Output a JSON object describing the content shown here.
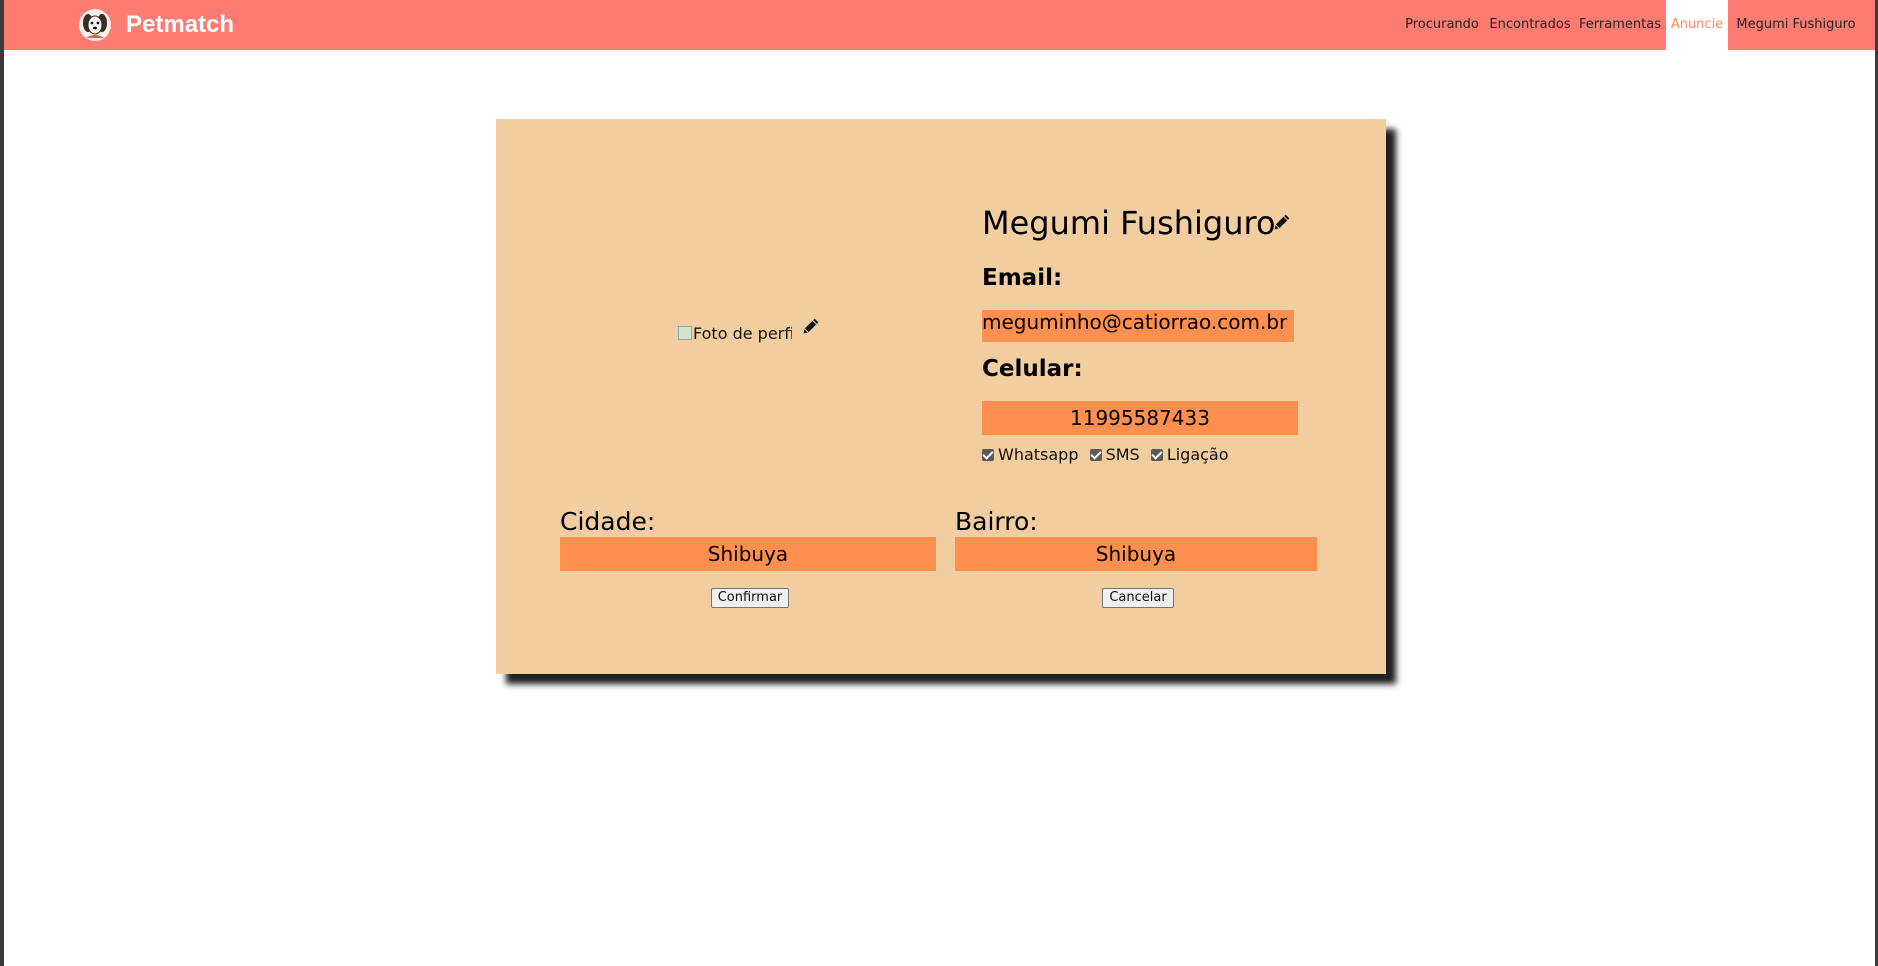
{
  "brand": {
    "name": "Petmatch",
    "logo_icon": "dog-logo-icon"
  },
  "nav": {
    "items": [
      {
        "label": "Procurando",
        "active": false
      },
      {
        "label": "Encontrados",
        "active": false
      },
      {
        "label": "Ferramentas",
        "active": false
      },
      {
        "label": "Anuncie",
        "active": true
      },
      {
        "label": "Megumi Fushiguro",
        "active": false
      }
    ]
  },
  "profile": {
    "photo_alt": "Foto de perfil",
    "name": "Megumi Fushiguro",
    "email_label": "Email:",
    "email_value": "meguminho@catiorrao.com.br",
    "phone_label": "Celular:",
    "phone_value": "11995587433",
    "contact_options": [
      {
        "label": "Whatsapp",
        "checked": true
      },
      {
        "label": "SMS",
        "checked": true
      },
      {
        "label": "Ligação",
        "checked": true
      }
    ],
    "city_label": "Cidade:",
    "city_value": "Shibuya",
    "district_label": "Bairro:",
    "district_value": "Shibuya"
  },
  "actions": {
    "confirm_label": "Confirmar",
    "cancel_label": "Cancelar"
  },
  "colors": {
    "navbar": "#fd7c72",
    "card": "#f2cda0",
    "field": "#ff8f4e",
    "active_nav_text": "#fd8a5a"
  }
}
